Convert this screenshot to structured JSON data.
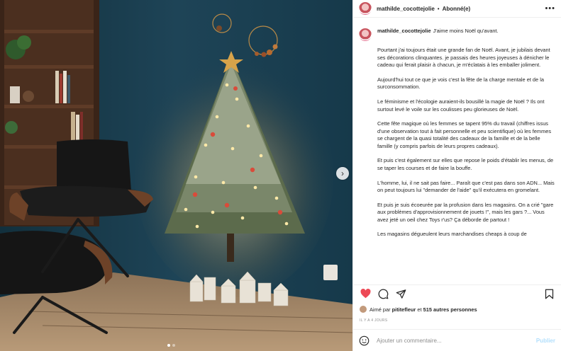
{
  "header": {
    "username": "mathilde_cocottejolie",
    "separator": "•",
    "follow_status": "Abonné(e)",
    "more": "•••"
  },
  "caption": {
    "username": "mathilde_cocottejolie",
    "paragraphs": [
      "J'aime moins Noël qu'avant.",
      "Pourtant j'ai toujours était une grande fan de Noël. Avant, je jubilais devant ses décorations clinquantes. je passais des heures joyeuses à dénicher le cadeau qui ferait plaisir à chacun, je m'éclatais à les emballer joliment.",
      "Aujourd'hui tout ce que je vois c'est la fête de la charge mentale et de la surconsommation.",
      "Le féminisme et l'écologie auraient-ils bousillé la magie de Noël ? Ils ont surtout levé le voile sur les coulisses peu glorieuses de Noël.",
      "Cette fête magique où les femmes se tapent 95% du travail (chiffres issus d'une observation tout à fait personnelle et peu scientifique) où les femmes se chargent de la quasi totalité des cadeaux de la famille et de la belle famille (y compris parfois de leurs propres cadeaux).",
      "Et puis c'est également sur elles que repose le poids d'établir les menus, de se taper les courses et de faire la bouffe.",
      "L'homme, lui, il ne sait pas faire... Paraît que c'est pas dans son ADN... Mais on peut toujours lui \"demander de l'aide\" qu'il exécutera en gromelant.",
      "Et puis je suis écoeurée par la profusion dans les magasins. On a crié \"gare aux problèmes d'approvisionnement de jouets !\", mais les gars ?... Vous avez jeté un oeil chez Toys r'us? Ça déborde de partout !",
      "Les magasins dégueulent leurs marchandises cheaps à coup de"
    ]
  },
  "likes": {
    "prefix": "Aimé par",
    "user": "pititefleur",
    "conjunction": "et",
    "others": "515 autres personnes"
  },
  "timestamp": "IL Y A 4 JOURS",
  "comment_box": {
    "placeholder": "Ajouter un commentaire...",
    "publish": "Publier"
  },
  "carousel": {
    "next_arrow": "›",
    "dot_count": 2,
    "active_dot": 1
  },
  "icons": {
    "like": "heart-icon",
    "comment": "comment-icon",
    "share": "share-icon",
    "save": "bookmark-icon",
    "emoji": "emoji-icon"
  },
  "colors": {
    "like_heart": "#ed4956",
    "publish_disabled": "#b2dffc",
    "wall": "#1b3a4a"
  }
}
